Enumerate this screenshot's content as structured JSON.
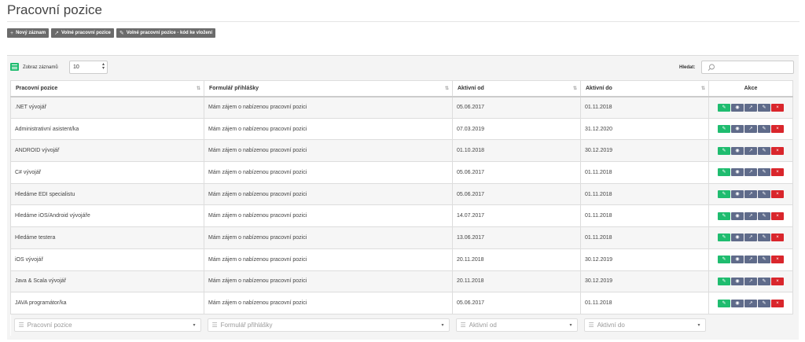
{
  "page": {
    "title": "Pracovní pozice"
  },
  "toolbar": [
    {
      "label": "Nový záznam",
      "icon": "+"
    },
    {
      "label": "Volné pracovní pozice",
      "icon": "↗"
    },
    {
      "label": "Volné pracovní pozice - kód ke vložení",
      "icon": "✎"
    }
  ],
  "controls": {
    "show_label": "Zobraz záznamů",
    "page_length": "10",
    "search_label": "Hledat:",
    "search_value": ""
  },
  "table": {
    "columns": [
      "Pracovní pozice",
      "Formulář přihlášky",
      "Aktivní od",
      "Aktivní do",
      "Akce"
    ],
    "rows": [
      [
        ".NET vývojář",
        "Mám zájem o nabízenou pracovní pozici",
        "05.06.2017",
        "01.11.2018"
      ],
      [
        "Administrativní asistent/ka",
        "Mám zájem o nabízenou pracovní pozici",
        "07.03.2019",
        "31.12.2020"
      ],
      [
        "ANDROID vývojář",
        "Mám zájem o nabízenou pracovní pozici",
        "01.10.2018",
        "30.12.2019"
      ],
      [
        "C# vývojář",
        "Mám zájem o nabízenou pracovní pozici",
        "05.06.2017",
        "01.11.2018"
      ],
      [
        "Hledáme EDI specialistu",
        "Mám zájem o nabízenou pracovní pozici",
        "05.06.2017",
        "01.11.2018"
      ],
      [
        "Hledáme iOS/Android vývojáře",
        "Mám zájem o nabízenou pracovní pozici",
        "14.07.2017",
        "01.11.2018"
      ],
      [
        "Hledáme testera",
        "Mám zájem o nabízenou pracovní pozici",
        "13.06.2017",
        "01.11.2018"
      ],
      [
        "iOS vývojář",
        "Mám zájem o nabízenou pracovní pozici",
        "20.11.2018",
        "30.12.2019"
      ],
      [
        "Java & Scala vývojář",
        "Mám zájem o nabízenou pracovní pozici",
        "20.11.2018",
        "30.12.2019"
      ],
      [
        "JAVA programátor/ka",
        "Mám zájem o nabízenou pracovní pozici",
        "05.06.2017",
        "01.11.2018"
      ]
    ],
    "filters": [
      "Pracovní pozice",
      "Formulář přihlášky",
      "Aktivní od",
      "Aktivní do"
    ],
    "action_icons": [
      "edit-icon",
      "view-icon",
      "open-icon",
      "link-icon",
      "delete-icon"
    ]
  },
  "colors": {
    "green": "#1fbc6f",
    "slate": "#5f6b8a",
    "red": "#d9262c",
    "toolbar": "#6b6b6b"
  }
}
